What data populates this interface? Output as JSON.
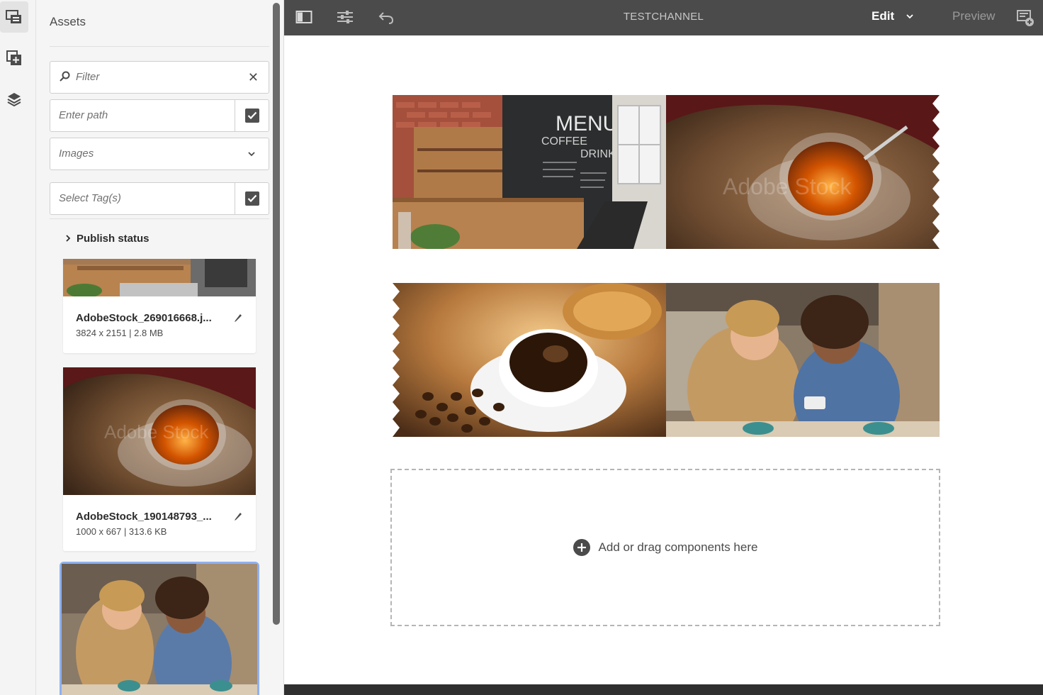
{
  "rail": {
    "items": [
      {
        "icon": "assets-icon",
        "active": true
      },
      {
        "icon": "components-icon",
        "active": false
      },
      {
        "icon": "layers-icon",
        "active": false
      }
    ]
  },
  "panel": {
    "title": "Assets",
    "filter_placeholder": "Filter",
    "path_placeholder": "Enter path",
    "type_value": "Images",
    "tags_placeholder": "Select Tag(s)",
    "publish_status_label": "Publish status",
    "assets": [
      {
        "name": "AdobeStock_269016668.j...",
        "meta": "3824 x 2151 | 2.8 MB"
      },
      {
        "name": "AdobeStock_190148793_...",
        "meta": "1000 x 667 | 313.6 KB"
      },
      {
        "name": "",
        "meta": ""
      }
    ]
  },
  "toolbar": {
    "channel_title": "TESTCHANNEL",
    "mode_label": "Edit",
    "preview_label": "Preview"
  },
  "canvas": {
    "drop_label": "Add or drag components here",
    "tile_texts": {
      "menu": "MENU",
      "coffee": "COFFEE",
      "drink": "DRINK",
      "watermark": "Adobe Stock"
    }
  },
  "colors": {
    "toolbar_bg": "#4b4b4b",
    "selection_outline": "#8fb0ee",
    "panel_bg": "#f5f5f5"
  }
}
